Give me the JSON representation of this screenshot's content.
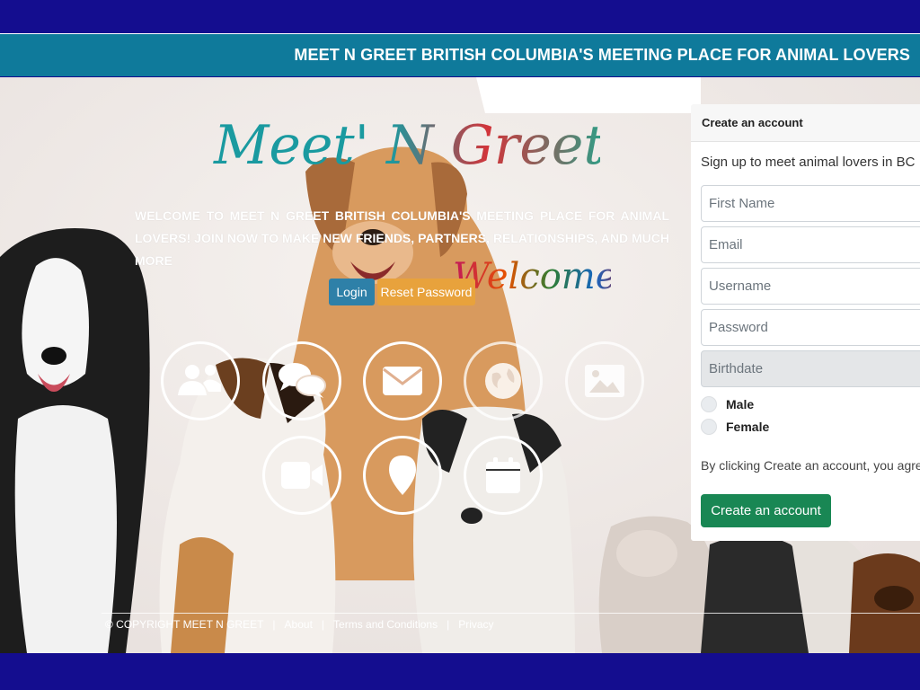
{
  "header": {
    "title": "MEET N GREET BRITISH COLUMBIA'S MEETING PLACE FOR ANIMAL LOVERS"
  },
  "hero": {
    "logo_text": "Meet' N Greet",
    "welcome_text": "Welcome!",
    "intro": "WELCOME TO MEET N GREET BRITISH COLUMBIA'S MEETING PLACE FOR ANIMAL LOVERS! JOIN NOW TO MAKE NEW FRIENDS, PARTNERS, RELATIONSHIPS, AND MUCH MORE",
    "login_label": "Login",
    "reset_label": "Reset Password"
  },
  "feature_icons": [
    "users-icon",
    "chat-icon",
    "envelope-icon",
    "globe-icon",
    "image-icon",
    "video-camera-icon",
    "map-pin-icon",
    "calendar-icon"
  ],
  "footer": {
    "copyright": "© COPYRIGHT MEET N GREET",
    "about": "About",
    "terms": "Terms and Conditions",
    "privacy": "Privacy",
    "separator": "|"
  },
  "signup": {
    "heading": "Create an account",
    "subtitle": "Sign up to meet animal lovers in BC",
    "first_name_placeholder": "First Name",
    "email_placeholder": "Email",
    "username_placeholder": "Username",
    "password_placeholder": "Password",
    "birthdate_placeholder": "Birthdate",
    "male_label": "Male",
    "female_label": "Female",
    "terms_text": "By clicking Create an account, you agre",
    "submit_label": "Create an account"
  },
  "colors": {
    "navy": "#140d8f",
    "teal_header": "#0f7a9b",
    "login_blue": "#2e80a8",
    "reset_orange": "#e8a23c",
    "create_green": "#198754"
  }
}
